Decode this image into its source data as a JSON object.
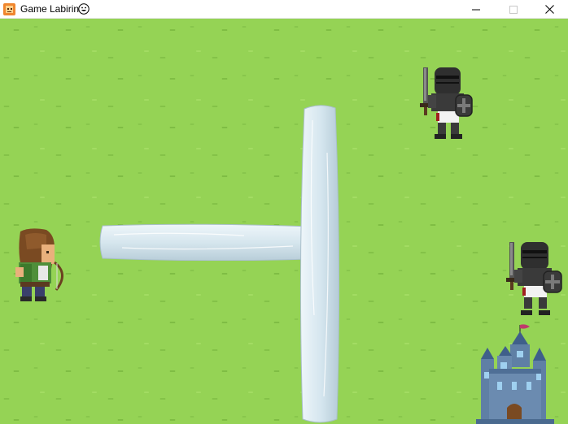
{
  "window": {
    "title": "Game Labirin",
    "title_emoji_icon": "grinning-face-icon",
    "app_icon": "game-app-icon",
    "controls": [
      "minimize-icon",
      "maximize-icon",
      "close-icon"
    ]
  },
  "scene": {
    "background": "grass-field",
    "colors": {
      "grass": "#95d355",
      "ice": "#dceaf2",
      "castle": "#5f7fa5",
      "knight_armor": "#333333",
      "archer_tunic": "#4f8f3a"
    },
    "entities": [
      {
        "id": "player-archer",
        "sprite": "archer-icon"
      },
      {
        "id": "enemy-knight-1",
        "sprite": "knight-icon"
      },
      {
        "id": "enemy-knight-2",
        "sprite": "knight-icon"
      },
      {
        "id": "goal-castle",
        "sprite": "castle-icon"
      }
    ],
    "walls": [
      {
        "id": "ice-wall-horizontal",
        "orientation": "horizontal"
      },
      {
        "id": "ice-wall-vertical",
        "orientation": "vertical"
      }
    ]
  }
}
